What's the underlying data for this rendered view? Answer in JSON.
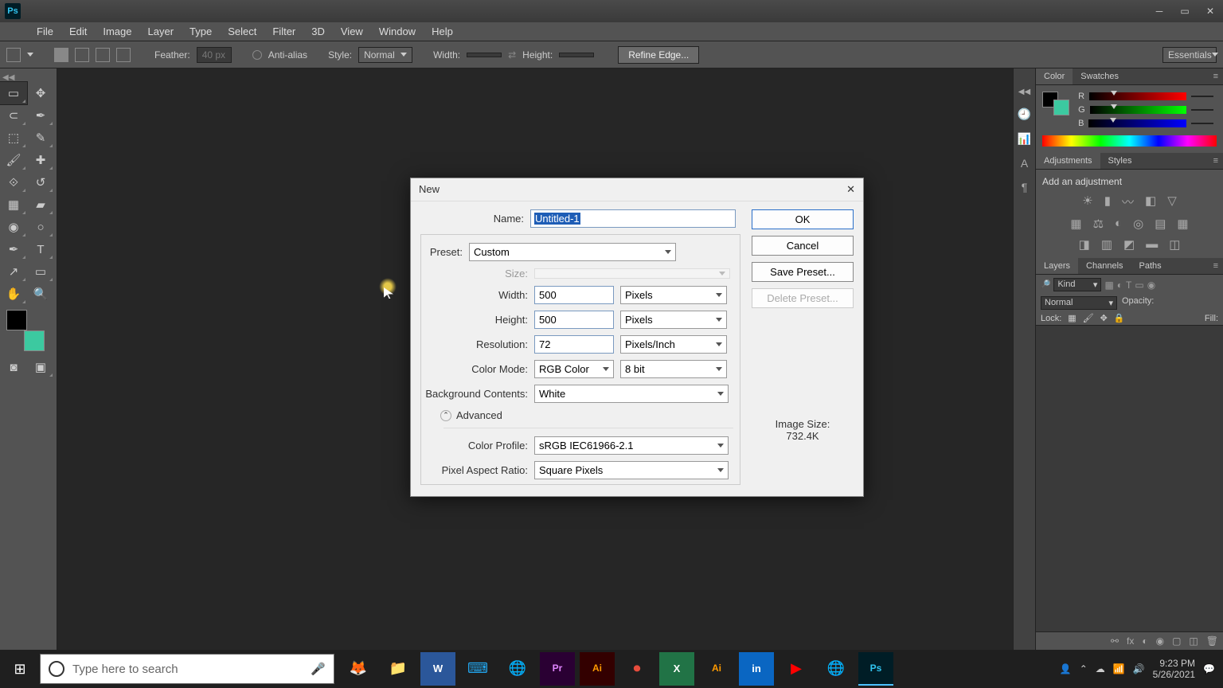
{
  "titlebar": {
    "logo": "Ps"
  },
  "menubar": {
    "items": [
      "File",
      "Edit",
      "Image",
      "Layer",
      "Type",
      "Select",
      "Filter",
      "3D",
      "View",
      "Window",
      "Help"
    ]
  },
  "optbar": {
    "feather_label": "Feather:",
    "feather_value": "40 px",
    "antialias": "Anti-alias",
    "style_label": "Style:",
    "style_value": "Normal",
    "width_label": "Width:",
    "height_label": "Height:",
    "refine": "Refine Edge...",
    "workspace": "Essentials"
  },
  "panels": {
    "color_tab": "Color",
    "swatches_tab": "Swatches",
    "r_label": "R",
    "g_label": "G",
    "b_label": "B",
    "adjustments_tab": "Adjustments",
    "styles_tab": "Styles",
    "add_adjustment": "Add an adjustment",
    "layers_tab": "Layers",
    "channels_tab": "Channels",
    "paths_tab": "Paths",
    "kind_label": "Kind",
    "blend_mode": "Normal",
    "opacity_label": "Opacity:",
    "lock_label": "Lock:",
    "fill_label": "Fill:"
  },
  "dialog": {
    "title": "New",
    "name_label": "Name:",
    "name_value": "Untitled-1",
    "preset_label": "Preset:",
    "preset_value": "Custom",
    "size_label": "Size:",
    "width_label": "Width:",
    "width_value": "500",
    "width_unit": "Pixels",
    "height_label": "Height:",
    "height_value": "500",
    "height_unit": "Pixels",
    "resolution_label": "Resolution:",
    "resolution_value": "72",
    "resolution_unit": "Pixels/Inch",
    "colormode_label": "Color Mode:",
    "colormode_value": "RGB Color",
    "colormode_bits": "8 bit",
    "bg_label": "Background Contents:",
    "bg_value": "White",
    "advanced_label": "Advanced",
    "profile_label": "Color Profile:",
    "profile_value": "sRGB IEC61966-2.1",
    "par_label": "Pixel Aspect Ratio:",
    "par_value": "Square Pixels",
    "ok": "OK",
    "cancel": "Cancel",
    "save_preset": "Save Preset...",
    "delete_preset": "Delete Preset...",
    "image_size_label": "Image Size:",
    "image_size_value": "732.4K"
  },
  "taskbar": {
    "search_placeholder": "Type here to search",
    "time": "9:23 PM",
    "date": "5/26/2021"
  }
}
